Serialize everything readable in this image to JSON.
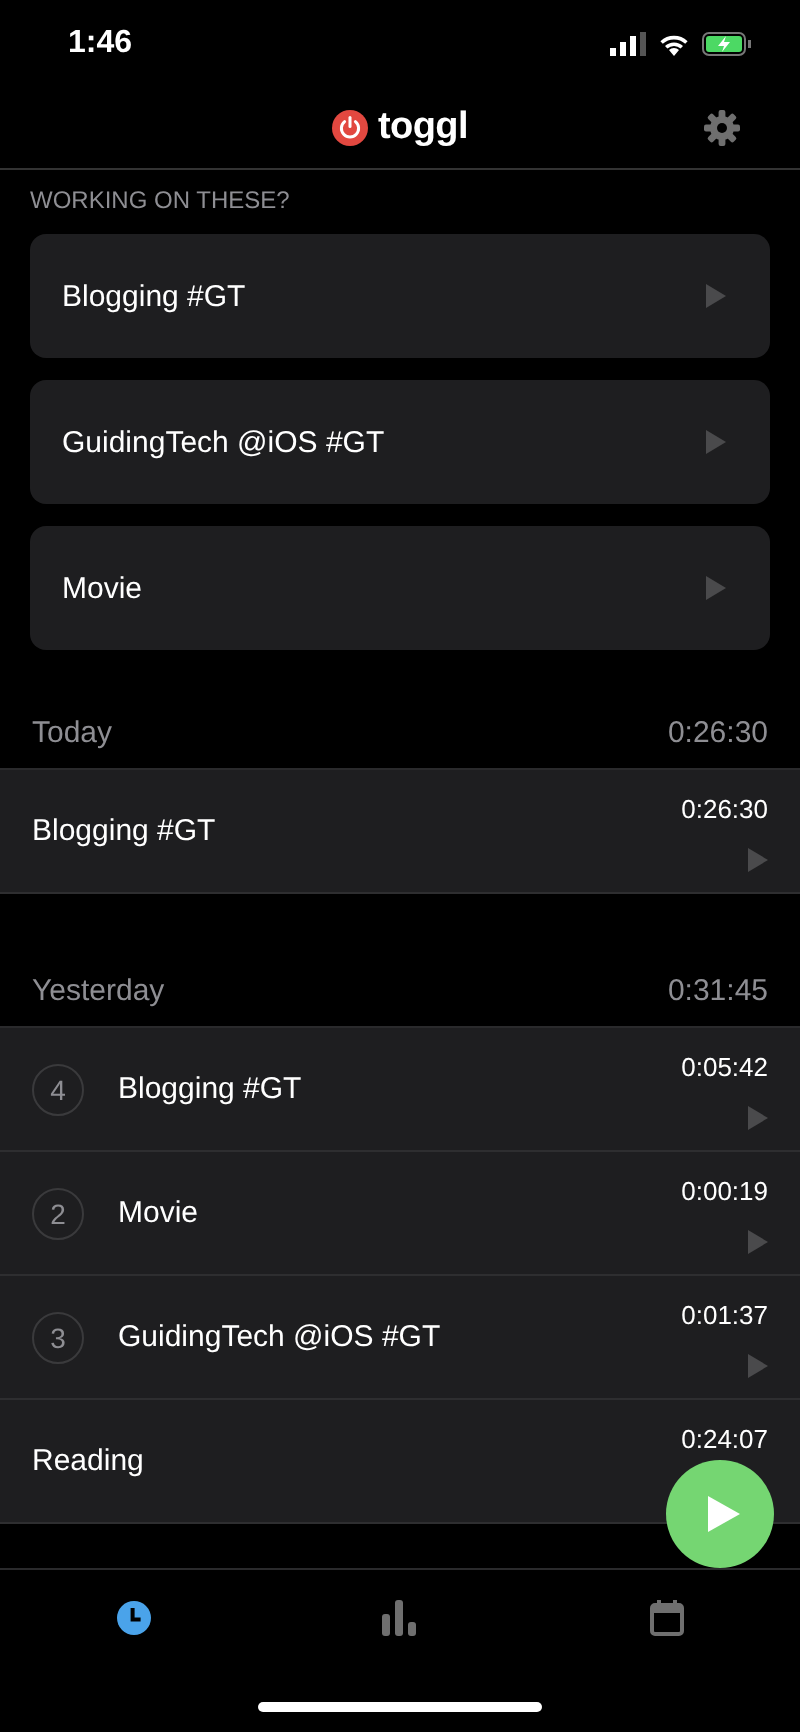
{
  "status_bar": {
    "time": "1:46"
  },
  "header": {
    "logo_text": "toggl"
  },
  "suggestions": {
    "title": "WORKING ON THESE?",
    "items": [
      {
        "description": "Blogging #GT"
      },
      {
        "description": "GuidingTech @iOS #GT"
      },
      {
        "description": "Movie"
      }
    ]
  },
  "days": [
    {
      "label": "Today",
      "total": "0:26:30",
      "entries": [
        {
          "description": "Blogging #GT",
          "duration": "0:26:30"
        }
      ]
    },
    {
      "label": "Yesterday",
      "total": "0:31:45",
      "entries": [
        {
          "group_count": "4",
          "description": "Blogging #GT",
          "duration": "0:05:42"
        },
        {
          "group_count": "2",
          "description": "Movie",
          "duration": "0:00:19"
        },
        {
          "group_count": "3",
          "description": "GuidingTech @iOS #GT",
          "duration": "0:01:37"
        },
        {
          "description": "Reading",
          "duration": "0:24:07"
        }
      ]
    }
  ],
  "tab_bar": {
    "tabs": [
      {
        "kind": "timer",
        "selected": true
      },
      {
        "kind": "reports",
        "selected": false
      },
      {
        "kind": "calendar",
        "selected": false
      }
    ]
  }
}
